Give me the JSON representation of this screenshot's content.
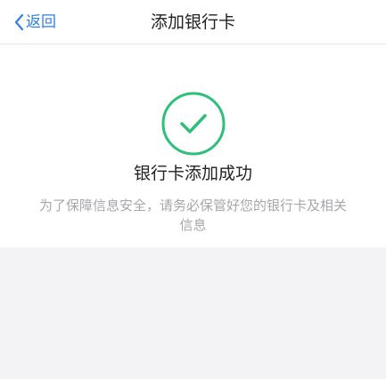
{
  "nav": {
    "back_label": "返回",
    "title": "添加银行卡",
    "back_icon": "chevron-left-icon"
  },
  "result": {
    "icon": "checkmark-circle-icon",
    "title": "银行卡添加成功",
    "description": "为了保障信息安全，请务必保管好您的银行卡及相关信息"
  },
  "colors": {
    "accent": "#2f7ee3",
    "success": "#2ec07b",
    "background": "#f3f3f6",
    "title_text": "#222222",
    "secondary_text": "#a7a7ab"
  }
}
